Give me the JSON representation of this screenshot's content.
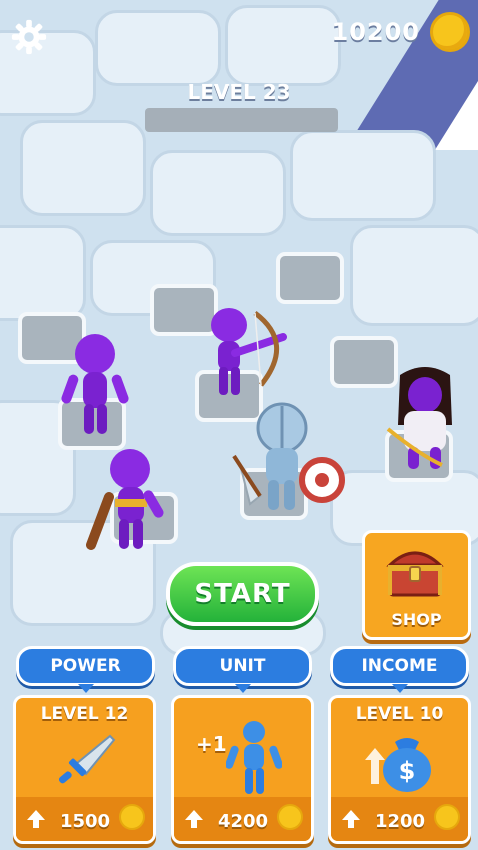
{
  "hud": {
    "settings_icon": "gear-icon",
    "coins": "10200",
    "coin_icon": "coin-icon"
  },
  "level": {
    "title": "LEVEL 23",
    "progress": 0
  },
  "buttons": {
    "start": "START",
    "shop": "SHOP"
  },
  "upgrades": [
    {
      "tag": "POWER",
      "level": "LEVEL 12",
      "icon": "sword-icon",
      "price": "1500"
    },
    {
      "tag": "UNIT",
      "level": "",
      "unit_plus": "+1",
      "icon": "stickman-icon",
      "price": "4200"
    },
    {
      "tag": "INCOME",
      "level": "LEVEL 10",
      "icon": "money-bag-icon",
      "price": "1200"
    }
  ],
  "colors": {
    "start_green": "#2fbf44",
    "card_orange": "#f6a01f",
    "tag_blue": "#2c7de0",
    "enemy_purple": "#8a2be2",
    "ally_steel": "#8fb7d8"
  }
}
